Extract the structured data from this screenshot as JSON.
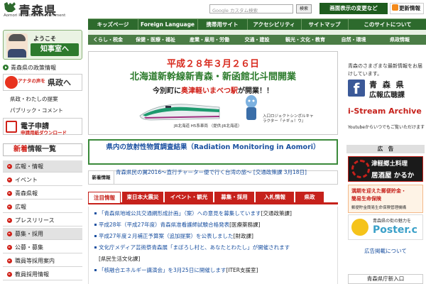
{
  "header": {
    "pref_name": "青森県",
    "pref_name_en": "Aomori Prefectural Government",
    "search_placeholder": "Google カスタム検索",
    "search_button": "検索",
    "view_change": "画面表示の変更など",
    "rss": "更新情報"
  },
  "nav1": [
    "キッズページ",
    "Foreign Language",
    "携帯用サイト",
    "アクセシビリティ",
    "サイトマップ",
    "このサイトについて"
  ],
  "nav2": [
    "くらし・税金",
    "保健・医療・福祉",
    "産業・雇用・労働",
    "交通・建設",
    "観光・文化・教育",
    "自然・環境",
    "県政情報"
  ],
  "left": {
    "governor_greeting": "ようこそ",
    "governor_room": "知事室へ",
    "policy_info": "青森県の政策情報",
    "voice_prefix": "アナタの声を",
    "voice_main": "県政へ",
    "links": [
      "県政・わたしの提案",
      "パブリック・コメント"
    ],
    "apply_title": "電子申請",
    "apply_sub": "申請用紙ダウンロード",
    "news_title_red": "新着",
    "news_title_rest": "情報一覧",
    "menu": [
      {
        "label": "広報・情報",
        "cat": true
      },
      {
        "label": "イベント",
        "cat": false
      },
      {
        "label": "青森県報",
        "cat": false
      },
      {
        "label": "広報",
        "cat": false
      },
      {
        "label": "プレスリリース",
        "cat": false
      },
      {
        "label": "募集・採用",
        "cat": true
      },
      {
        "label": "公募・募集",
        "cat": false
      },
      {
        "label": "職員等採用案内",
        "cat": false
      },
      {
        "label": "教員採用情報",
        "cat": false
      }
    ]
  },
  "banner": {
    "date": "平成２８年３月２６日",
    "main": "北海道新幹線新青森・新函館北斗間開業",
    "sub_prefix": "今別町に",
    "sub_highlight": "奥津軽いまべつ駅",
    "sub_suffix": "が開業！！",
    "caption_train": "JR北海道 H5系車両\n（提供:JR北海道）",
    "caption_mascot": "入口ロジェクトシンボルキャラクター『ナギュ！ウ』"
  },
  "radiation": "県内の放射性物質調査結果（Radiation Monitoring in Aomori）",
  "ticker": {
    "label": "新着情報",
    "text": "青森県民の翼2016〜直行チャーター便で行く台湾の旅〜 [交通政策課 3月18日]"
  },
  "tabs": [
    {
      "label": "注目情報",
      "active": true
    },
    {
      "label": "東日本大震災",
      "active": false
    },
    {
      "label": "イベント・観光",
      "active": false
    },
    {
      "label": "募集・採用",
      "active": false
    },
    {
      "label": "入札情報",
      "active": false
    },
    {
      "label": "県政",
      "active": false
    }
  ],
  "news": [
    {
      "link": "「青森県地域公共交通網形成計画」（案）への意見を募集しています",
      "dept": "[交通政策課]"
    },
    {
      "link": "平成28年（平成27年度）青森県准看護師試験合格発表",
      "dept": "[医療薬務課]"
    },
    {
      "link": "平成27年度２月補正予算案（追加提案）を公表しました",
      "dept": "[財政課]"
    },
    {
      "link": "文化庁メディア芸術祭青森展「まぼろし村と、あなたとわたし」が開催されます",
      "dept": ""
    },
    {
      "link": "",
      "dept": "[県民生活文化課]"
    },
    {
      "link": "「核融合エネルギー講演会」を3月25日に開催します",
      "dept": "[ITER支援室]"
    }
  ],
  "right": {
    "desc": "青森のさまざまな最新情報をお届けしています。",
    "fb_t1": "青 森 県",
    "fb_t2": "広報広聴課",
    "stream_t1": "i-Stream Archive",
    "stream_t2": "Youtubeからいつでもご覧いただけます",
    "ad_label": "広　告",
    "ad1_t1": "津軽郷土料理",
    "ad1_t2": "居酒屋 かるか",
    "ad2_t1": "満期を迎えた郵便貯金・",
    "ad2_t2": "簡易生命保険",
    "ad2_t3": "郵便貯金簡易生命保険管理機構",
    "ad3_t1": "青森県の街の魅力を",
    "ad3_t2": "Poster.c",
    "ad_more": "広告掲載について",
    "entrance": "青森県庁新入口"
  },
  "colors": {
    "brand_green": "#2d6a2d",
    "accent_red": "#c6211b",
    "link_blue": "#1a50a0"
  }
}
